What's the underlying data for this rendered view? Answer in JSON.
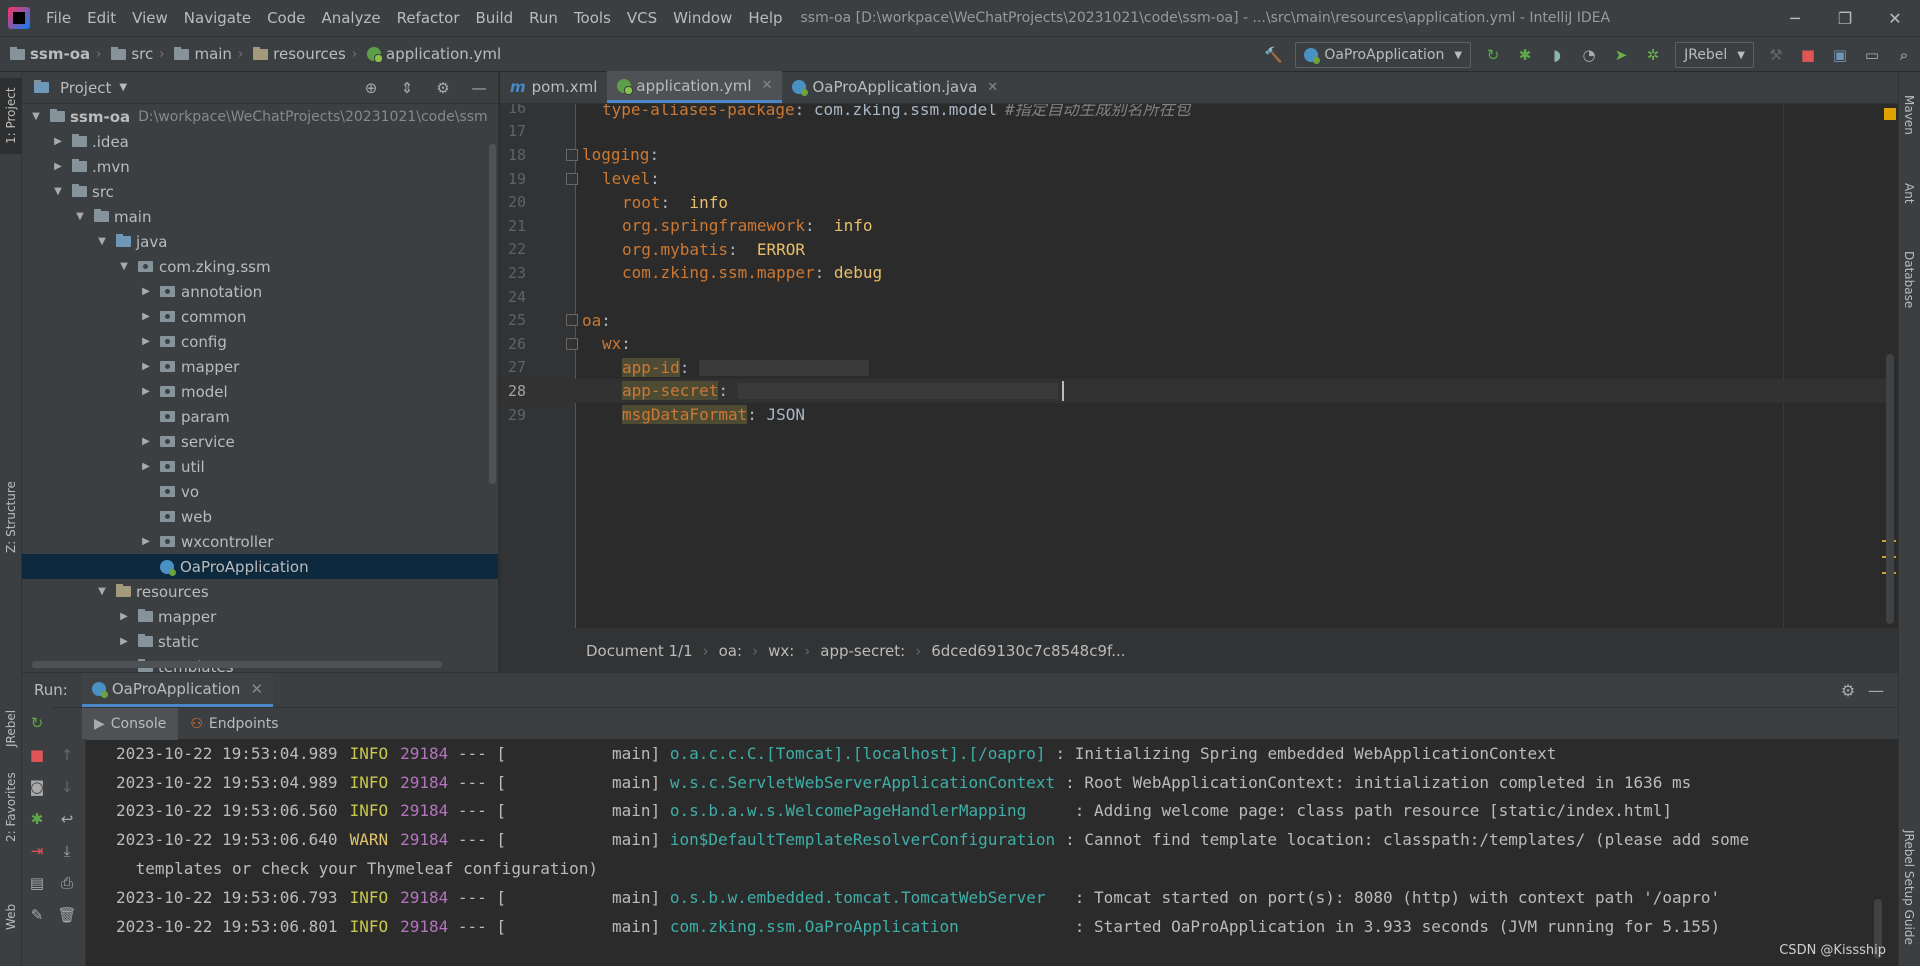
{
  "titlebar": {
    "menus": [
      "File",
      "Edit",
      "View",
      "Navigate",
      "Code",
      "Analyze",
      "Refactor",
      "Build",
      "Run",
      "Tools",
      "VCS",
      "Window",
      "Help"
    ],
    "title": "ssm-oa [D:\\workpace\\WeChatProjects\\20231021\\code\\ssm-oa] - ...\\src\\main\\resources\\application.yml - IntelliJ IDEA",
    "minimize_icon": "─",
    "restore_icon": "❐",
    "close_icon": "✕"
  },
  "navbar": {
    "crumbs": [
      "ssm-oa",
      "src",
      "main",
      "resources",
      "application.yml"
    ],
    "run_config": "OaProApplication",
    "jrebel": "JRebel"
  },
  "stripes": {
    "left": [
      "1: Project",
      "Z: Structure",
      "JRebel",
      "2: Favorites",
      "Web"
    ],
    "right": [
      "Maven",
      "Ant",
      "Database",
      "JRebel Setup Guide"
    ]
  },
  "project": {
    "title": "Project",
    "root": {
      "name": "ssm-oa",
      "path": "D:\\workpace\\WeChatProjects\\20231021\\code\\ssm"
    },
    "rows": [
      {
        "name": ".idea",
        "level": 1,
        "arrow": "▶",
        "icon": "folder"
      },
      {
        "name": ".mvn",
        "level": 1,
        "arrow": "▶",
        "icon": "folder"
      },
      {
        "name": "src",
        "level": 1,
        "arrow": "▼",
        "icon": "folder"
      },
      {
        "name": "main",
        "level": 2,
        "arrow": "▼",
        "icon": "folder"
      },
      {
        "name": "java",
        "level": 3,
        "arrow": "▼",
        "icon": "folder-blue"
      },
      {
        "name": "com.zking.ssm",
        "level": 4,
        "arrow": "▼",
        "icon": "package"
      },
      {
        "name": "annotation",
        "level": 5,
        "arrow": "▶",
        "icon": "package"
      },
      {
        "name": "common",
        "level": 5,
        "arrow": "▶",
        "icon": "package"
      },
      {
        "name": "config",
        "level": 5,
        "arrow": "▶",
        "icon": "package"
      },
      {
        "name": "mapper",
        "level": 5,
        "arrow": "▶",
        "icon": "package"
      },
      {
        "name": "model",
        "level": 5,
        "arrow": "▶",
        "icon": "package"
      },
      {
        "name": "param",
        "level": 5,
        "arrow": "",
        "icon": "package"
      },
      {
        "name": "service",
        "level": 5,
        "arrow": "▶",
        "icon": "package"
      },
      {
        "name": "util",
        "level": 5,
        "arrow": "▶",
        "icon": "package"
      },
      {
        "name": "vo",
        "level": 5,
        "arrow": "",
        "icon": "package"
      },
      {
        "name": "web",
        "level": 5,
        "arrow": "",
        "icon": "package"
      },
      {
        "name": "wxcontroller",
        "level": 5,
        "arrow": "▶",
        "icon": "package"
      },
      {
        "name": "OaProApplication",
        "level": 5,
        "arrow": "",
        "icon": "spring",
        "selected": true
      },
      {
        "name": "resources",
        "level": 3,
        "arrow": "▼",
        "icon": "folder-res"
      },
      {
        "name": "mapper",
        "level": 4,
        "arrow": "▶",
        "icon": "folder"
      },
      {
        "name": "static",
        "level": 4,
        "arrow": "▶",
        "icon": "folder"
      },
      {
        "name": "templates",
        "level": 4,
        "arrow": "",
        "icon": "folder"
      }
    ]
  },
  "editor": {
    "tabs": [
      {
        "label": "pom.xml",
        "active": false
      },
      {
        "label": "application.yml",
        "active": true
      },
      {
        "label": "OaProApplication.java",
        "active": false
      }
    ],
    "lines": [
      {
        "n": "16",
        "key": "type-aliases-package",
        "val": "com.zking.ssm.model",
        "comment": "#指定自动生成别名所在包",
        "indent": 1
      },
      {
        "n": "17"
      },
      {
        "n": "18",
        "key": "logging",
        "indent": 0
      },
      {
        "n": "19",
        "key": "level",
        "indent": 1
      },
      {
        "n": "20",
        "key": "root",
        "val": " info",
        "indent": 2
      },
      {
        "n": "21",
        "key": "org.springframework",
        "val": " info",
        "indent": 2
      },
      {
        "n": "22",
        "key": "org.mybatis",
        "val": " ERROR",
        "indent": 2
      },
      {
        "n": "23",
        "key": "com.zking.ssm.mapper",
        "val": "debug",
        "indent": 2
      },
      {
        "n": "24"
      },
      {
        "n": "25",
        "key": "oa",
        "indent": 0
      },
      {
        "n": "26",
        "key": "wx",
        "indent": 1
      },
      {
        "n": "27",
        "key": "app-id",
        "indent": 2,
        "redacted": true
      },
      {
        "n": "28",
        "key": "app-secret",
        "indent": 2,
        "redacted": true,
        "current": true
      },
      {
        "n": "29",
        "key": "msgDataFormat",
        "val": "JSON",
        "indent": 2
      }
    ],
    "breadcrumbs": [
      "Document 1/1",
      "oa:",
      "wx:",
      "app-secret:",
      "6dced69130c7c8548c9f..."
    ]
  },
  "run": {
    "label": "Run:",
    "tab": "OaProApplication",
    "subtabs": [
      "Console",
      "Endpoints"
    ],
    "log": [
      {
        "ts": "2023-10-22 19:53:04.989",
        "level": "INFO",
        "pid": "29184",
        "thread": "main",
        "logger": "o.a.c.c.C.[Tomcat].[localhost].[/oapro]",
        "msg": ": Initializing Spring embedded WebApplicationContext"
      },
      {
        "ts": "2023-10-22 19:53:04.989",
        "level": "INFO",
        "pid": "29184",
        "thread": "main",
        "logger": "w.s.c.ServletWebServerApplicationContext",
        "msg": ": Root WebApplicationContext: initialization completed in 1636 ms"
      },
      {
        "ts": "2023-10-22 19:53:06.560",
        "level": "INFO",
        "pid": "29184",
        "thread": "main",
        "logger": "o.s.b.a.w.s.WelcomePageHandlerMapping    ",
        "msg": ": Adding welcome page: class path resource [static/index.html]"
      },
      {
        "ts": "2023-10-22 19:53:06.640",
        "level": "WARN",
        "pid": "29184",
        "thread": "main",
        "logger": "ion$DefaultTemplateResolverConfiguration",
        "msg": ": Cannot find template location: classpath:/templates/ (please add some"
      },
      {
        "wrap": " templates or check your Thymeleaf configuration)"
      },
      {
        "ts": "2023-10-22 19:53:06.793",
        "level": "INFO",
        "pid": "29184",
        "thread": "main",
        "logger": "o.s.b.w.embedded.tomcat.TomcatWebServer  ",
        "msg": ": Tomcat started on port(s): 8080 (http) with context path '/oapro'"
      },
      {
        "ts": "2023-10-22 19:53:06.801",
        "level": "INFO",
        "pid": "29184",
        "thread": "main",
        "logger": "com.zking.ssm.OaProApplication           ",
        "msg": ": Started OaProApplication in 3.933 seconds (JVM running for 5.155)"
      }
    ],
    "watermark": "CSDN @Kissship"
  }
}
